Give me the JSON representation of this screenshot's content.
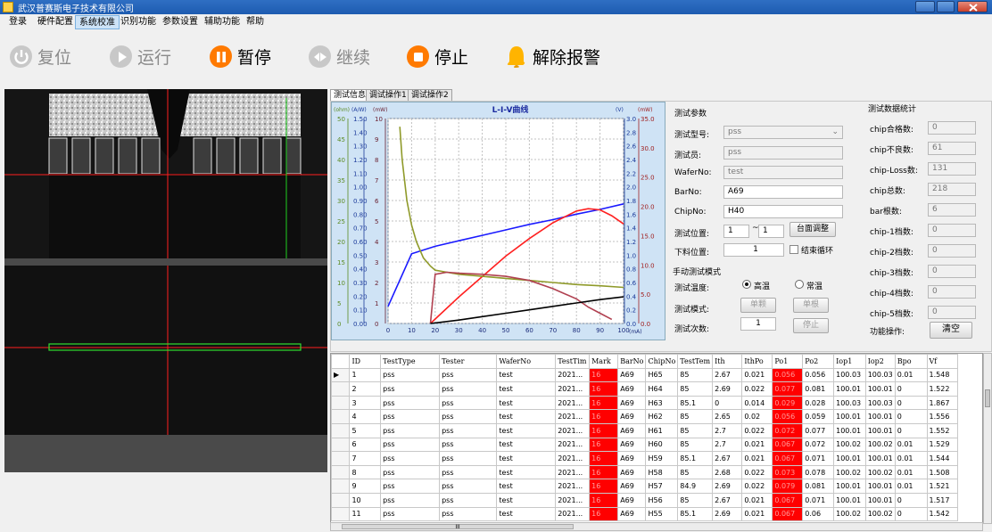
{
  "window": {
    "title": "武汉普赛斯电子技术有限公司"
  },
  "menu": [
    "登录",
    "硬件配置",
    "系统校准",
    "识别功能",
    "参数设置",
    "辅助功能",
    "帮助"
  ],
  "toolbar": [
    {
      "label": "复位",
      "state": "disabled",
      "icon": "power-icon"
    },
    {
      "label": "运行",
      "state": "disabled",
      "icon": "play-icon"
    },
    {
      "label": "暂停",
      "state": "enabled",
      "icon": "pause-icon"
    },
    {
      "label": "继续",
      "state": "disabled",
      "icon": "continue-icon"
    },
    {
      "label": "停止",
      "state": "enabled",
      "icon": "stop-icon"
    },
    {
      "label": "解除报警",
      "state": "enabled",
      "icon": "bell-icon"
    }
  ],
  "tabs": [
    "测试信息",
    "调试操作1",
    "调试操作2"
  ],
  "chart_data": {
    "type": "line",
    "title": "L-I-V曲线",
    "xlabel": "(mA)",
    "axis_units": [
      "(ohm)",
      "(A/W)",
      "(mW)",
      "(V)",
      "(mW)"
    ],
    "xlim": [
      0,
      100
    ],
    "x_ticks": [
      0,
      10,
      20,
      30,
      40,
      50,
      60,
      70,
      80,
      90,
      100
    ],
    "axes": {
      "ohm": {
        "ticks": [
          "0",
          "5",
          "10",
          "15",
          "20",
          "25",
          "30",
          "35",
          "40",
          "45",
          "50"
        ],
        "lim": [
          0,
          50
        ]
      },
      "aw": {
        "ticks": [
          "0.00",
          "0.10",
          "0.20",
          "0.30",
          "0.40",
          "0.50",
          "0.60",
          "0.70",
          "0.80",
          "0.90",
          "1.00",
          "1.10",
          "1.20",
          "1.30",
          "1.40",
          "1.50"
        ],
        "lim": [
          0,
          1.5
        ]
      },
      "mw_left": {
        "ticks": [
          "0",
          "1",
          "2",
          "3",
          "4",
          "5",
          "6",
          "7",
          "8",
          "9",
          "10"
        ],
        "lim": [
          0,
          10
        ]
      },
      "v": {
        "ticks": [
          "0.0",
          "0.2",
          "0.4",
          "0.6",
          "0.8",
          "1.0",
          "1.2",
          "1.4",
          "1.6",
          "1.8",
          "2.0",
          "2.2",
          "2.4",
          "2.6",
          "2.8",
          "3.0"
        ],
        "lim": [
          0,
          3.0
        ]
      },
      "mw_right": {
        "ticks": [
          "0.0",
          "5.0",
          "10.0",
          "15.0",
          "20.0",
          "25.0",
          "30.0",
          "35.0"
        ],
        "lim": [
          0,
          35
        ]
      }
    },
    "series": [
      {
        "axis": "v",
        "color": "#1a1aff",
        "x": [
          0,
          10,
          20,
          30,
          40,
          50,
          60,
          70,
          80,
          90,
          100
        ],
        "y": [
          0.25,
          1.02,
          1.13,
          1.21,
          1.29,
          1.37,
          1.45,
          1.52,
          1.6,
          1.67,
          1.75
        ]
      },
      {
        "axis": "mw_right",
        "color": "#ff2020",
        "x": [
          18,
          30,
          40,
          50,
          60,
          70,
          80,
          85,
          90,
          95,
          100
        ],
        "y": [
          0,
          4.5,
          8,
          11.5,
          14.5,
          17.2,
          19.2,
          19.6,
          19.4,
          18.4,
          17
        ]
      },
      {
        "axis": "ohm",
        "color": "#8f9a2a",
        "x": [
          5,
          6,
          8,
          10,
          12,
          15,
          18,
          20,
          25,
          30,
          40,
          50,
          60,
          70,
          80,
          90,
          100
        ],
        "y": [
          48,
          40,
          30,
          24,
          20,
          16,
          14,
          13,
          12.5,
          12,
          11.5,
          11,
          10.5,
          10,
          9.5,
          9.2,
          8.8
        ]
      },
      {
        "axis": "mw_left",
        "color": "#b04050",
        "x": [
          18,
          20,
          25,
          30,
          40,
          50,
          60,
          70,
          80,
          85,
          90,
          95
        ],
        "y": [
          0,
          2.4,
          2.5,
          2.45,
          2.4,
          2.3,
          2.1,
          1.7,
          1.2,
          0.8,
          0.5,
          0.2
        ]
      },
      {
        "axis": "v",
        "color": "#000000",
        "x": [
          18,
          30,
          40,
          50,
          60,
          70,
          80,
          90,
          100
        ],
        "y": [
          0,
          0.05,
          0.1,
          0.15,
          0.2,
          0.25,
          0.3,
          0.35,
          0.39
        ]
      }
    ]
  },
  "params": {
    "group_title": "测试参数",
    "model_label": "测试型号:",
    "model_value": "pss",
    "tester_label": "测试员:",
    "tester_value": "pss",
    "wafer_label": "WaferNo:",
    "wafer_value": "test",
    "bar_label": "BarNo:",
    "bar_value": "A69",
    "chip_label": "ChipNo:",
    "chip_value": "H40",
    "pos_label": "测试位置:",
    "pos_from": "1",
    "pos_sep": "~",
    "pos_to": "1",
    "platform_btn": "台面调整",
    "unload_label": "下料位置:",
    "unload_value": "1",
    "end_loop_label": "结束循环",
    "manual_title": "手动测试模式",
    "temp_label": "测试温度:",
    "temp_high": "高温",
    "temp_normal": "常温",
    "mode_label": "测试模式:",
    "single_chip": "单颗",
    "single_bar": "单根",
    "count_label": "测试次数:",
    "count_value": "1",
    "stop_btn": "停止"
  },
  "stats": {
    "title": "测试数据统计",
    "rows": [
      {
        "label": "chip合格数:",
        "value": "0"
      },
      {
        "label": "chip不良数:",
        "value": "61"
      },
      {
        "label": "chip-Loss数:",
        "value": "131"
      },
      {
        "label": "chip总数:",
        "value": "218"
      },
      {
        "label": "bar根数:",
        "value": "6"
      },
      {
        "label": "chip-1档数:",
        "value": "0"
      },
      {
        "label": "chip-2档数:",
        "value": "0"
      },
      {
        "label": "chip-3档数:",
        "value": "0"
      },
      {
        "label": "chip-4档数:",
        "value": "0"
      },
      {
        "label": "chip-5档数:",
        "value": "0"
      }
    ],
    "func_label": "功能操作:",
    "clear_btn": "清空"
  },
  "table": {
    "columns": [
      "ID",
      "TestType",
      "Tester",
      "WaferNo",
      "TestTim",
      "Mark",
      "BarNo",
      "ChipNo",
      "TestTem",
      "Ith",
      "IthPo",
      "Po1",
      "Po2",
      "Iop1",
      "Iop2",
      "Bpo",
      "Vf"
    ],
    "rows": [
      [
        "1",
        "pss",
        "pss",
        "test",
        "2021...",
        "16",
        "A69",
        "H65",
        "85",
        "2.67",
        "0.021",
        "0.056",
        "0.056",
        "100.03",
        "100.03",
        "0.01",
        "1.548"
      ],
      [
        "2",
        "pss",
        "pss",
        "test",
        "2021...",
        "16",
        "A69",
        "H64",
        "85",
        "2.69",
        "0.022",
        "0.077",
        "0.081",
        "100.01",
        "100.01",
        "0",
        "1.522"
      ],
      [
        "3",
        "pss",
        "pss",
        "test",
        "2021...",
        "16",
        "A69",
        "H63",
        "85.1",
        "0",
        "0.014",
        "0.029",
        "0.028",
        "100.03",
        "100.03",
        "0",
        "1.867"
      ],
      [
        "4",
        "pss",
        "pss",
        "test",
        "2021...",
        "16",
        "A69",
        "H62",
        "85",
        "2.65",
        "0.02",
        "0.056",
        "0.059",
        "100.01",
        "100.01",
        "0",
        "1.556"
      ],
      [
        "5",
        "pss",
        "pss",
        "test",
        "2021...",
        "16",
        "A69",
        "H61",
        "85",
        "2.7",
        "0.022",
        "0.072",
        "0.077",
        "100.01",
        "100.01",
        "0",
        "1.552"
      ],
      [
        "6",
        "pss",
        "pss",
        "test",
        "2021...",
        "16",
        "A69",
        "H60",
        "85",
        "2.7",
        "0.021",
        "0.067",
        "0.072",
        "100.02",
        "100.02",
        "0.01",
        "1.529"
      ],
      [
        "7",
        "pss",
        "pss",
        "test",
        "2021...",
        "16",
        "A69",
        "H59",
        "85.1",
        "2.67",
        "0.021",
        "0.067",
        "0.071",
        "100.01",
        "100.01",
        "0.01",
        "1.544"
      ],
      [
        "8",
        "pss",
        "pss",
        "test",
        "2021...",
        "16",
        "A69",
        "H58",
        "85",
        "2.68",
        "0.022",
        "0.073",
        "0.078",
        "100.02",
        "100.02",
        "0.01",
        "1.508"
      ],
      [
        "9",
        "pss",
        "pss",
        "test",
        "2021...",
        "16",
        "A69",
        "H57",
        "84.9",
        "2.69",
        "0.022",
        "0.079",
        "0.081",
        "100.01",
        "100.01",
        "0.01",
        "1.521"
      ],
      [
        "10",
        "pss",
        "pss",
        "test",
        "2021...",
        "16",
        "A69",
        "H56",
        "85",
        "2.67",
        "0.021",
        "0.067",
        "0.071",
        "100.01",
        "100.01",
        "0",
        "1.517"
      ],
      [
        "11",
        "pss",
        "pss",
        "test",
        "2021...",
        "16",
        "A69",
        "H55",
        "85.1",
        "2.69",
        "0.021",
        "0.067",
        "0.06",
        "100.02",
        "100.02",
        "0",
        "1.542"
      ]
    ],
    "scroll_indicator": "III"
  }
}
